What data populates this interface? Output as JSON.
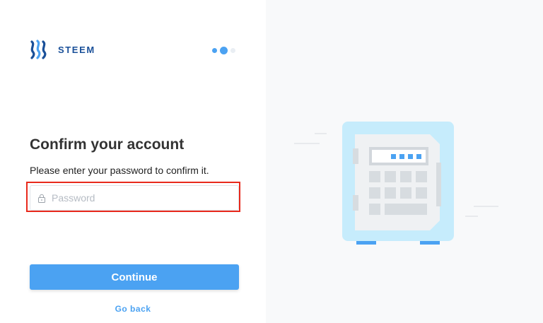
{
  "brand": {
    "name": "STEEM"
  },
  "steps": {
    "total": 3,
    "current": 2
  },
  "form": {
    "title": "Confirm your account",
    "subtitle": "Please enter your password to confirm it.",
    "password_placeholder": "Password",
    "continue_label": "Continue",
    "go_back_label": "Go back"
  },
  "illustration": {
    "icon": "safe-icon"
  },
  "colors": {
    "accent": "#4ba2f2",
    "brand": "#1a5099",
    "highlight": "#e8291c",
    "panel_bg": "#f8f9fa",
    "safe_body": "#c6ecfc"
  }
}
